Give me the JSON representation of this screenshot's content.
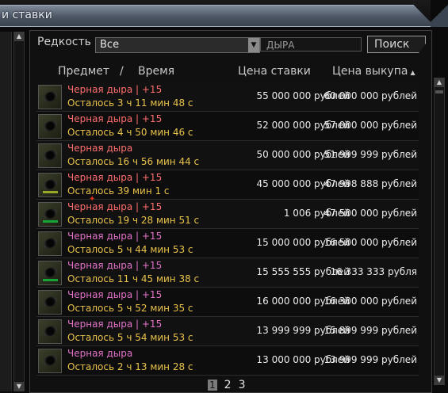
{
  "window": {
    "title": "и ставки"
  },
  "filters": {
    "rarity_label": "Редкость",
    "rarity_value": "Все",
    "search_value": "ДЫРА",
    "search_button": "Поиск"
  },
  "columns": {
    "item": "Предмет",
    "sep": "/",
    "time": "Время",
    "bid": "Цена ставки",
    "buyout": "Цена выкупа"
  },
  "colors": {
    "name_red": "#ff6d6d",
    "name_pink": "#e272c8",
    "time_yellow": "#e8c24a",
    "bar_green": "#17a436",
    "bar_olive": "#9aa82a"
  },
  "rows": [
    {
      "name": "Черная дыра | +15",
      "time": "Осталось 3 ч 11 мин 48 с",
      "bid": "55 000 000 рублей",
      "buyout": "60 000 000 рублей",
      "name_color": "red"
    },
    {
      "name": "Черная дыра | +15",
      "time": "Осталось 4 ч 50 мин 46 с",
      "bid": "52 000 000 рублей",
      "buyout": "57 000 000 рублей",
      "name_color": "red"
    },
    {
      "name": "Черная дыра",
      "time": "Осталось 16 ч 56 мин 44 с",
      "bid": "50 000 000 рублей",
      "buyout": "51 999 999 рублей",
      "name_color": "red"
    },
    {
      "name": "Черная дыра | +15",
      "time": "Осталось 39 мин 1 с",
      "bid": "45 000 000 рублей",
      "buyout": "47 998 888 рублей",
      "name_color": "red"
    },
    {
      "name": "Черная дыра | +15",
      "time": "Осталось 19 ч 28 мин 51 с",
      "bid": "1 006 рублей",
      "buyout": "47 500 000 рублей",
      "name_color": "red"
    },
    {
      "name": "Черная дыра | +15",
      "time": "Осталось 5 ч 44 мин 53 с",
      "bid": "15 000 000 рублей",
      "buyout": "16 500 000 рублей",
      "name_color": "pink"
    },
    {
      "name": "Черная дыра | +15",
      "time": "Осталось 11 ч 45 мин 38 с",
      "bid": "15 555 555 рублей",
      "buyout": "16 333 333 рубля",
      "name_color": "pink"
    },
    {
      "name": "Черная дыра | +15",
      "time": "Осталось 5 ч 52 мин 35 с",
      "bid": "16 000 000 рублей",
      "buyout": "16 300 000 рублей",
      "name_color": "pink"
    },
    {
      "name": "Черная дыра | +15",
      "time": "Осталось 5 ч 54 мин 53 с",
      "bid": "13 999 999 рублей",
      "buyout": "15 899 999 рублей",
      "name_color": "pink"
    },
    {
      "name": "Черная дыра",
      "time": "Осталось 2 ч 13 мин 28 с",
      "bid": "13 000 000 рублей",
      "buyout": "13 999 999 рублей",
      "name_color": "pink"
    }
  ],
  "pagination": {
    "pages": [
      "1",
      "2",
      "3"
    ],
    "current": "1"
  }
}
